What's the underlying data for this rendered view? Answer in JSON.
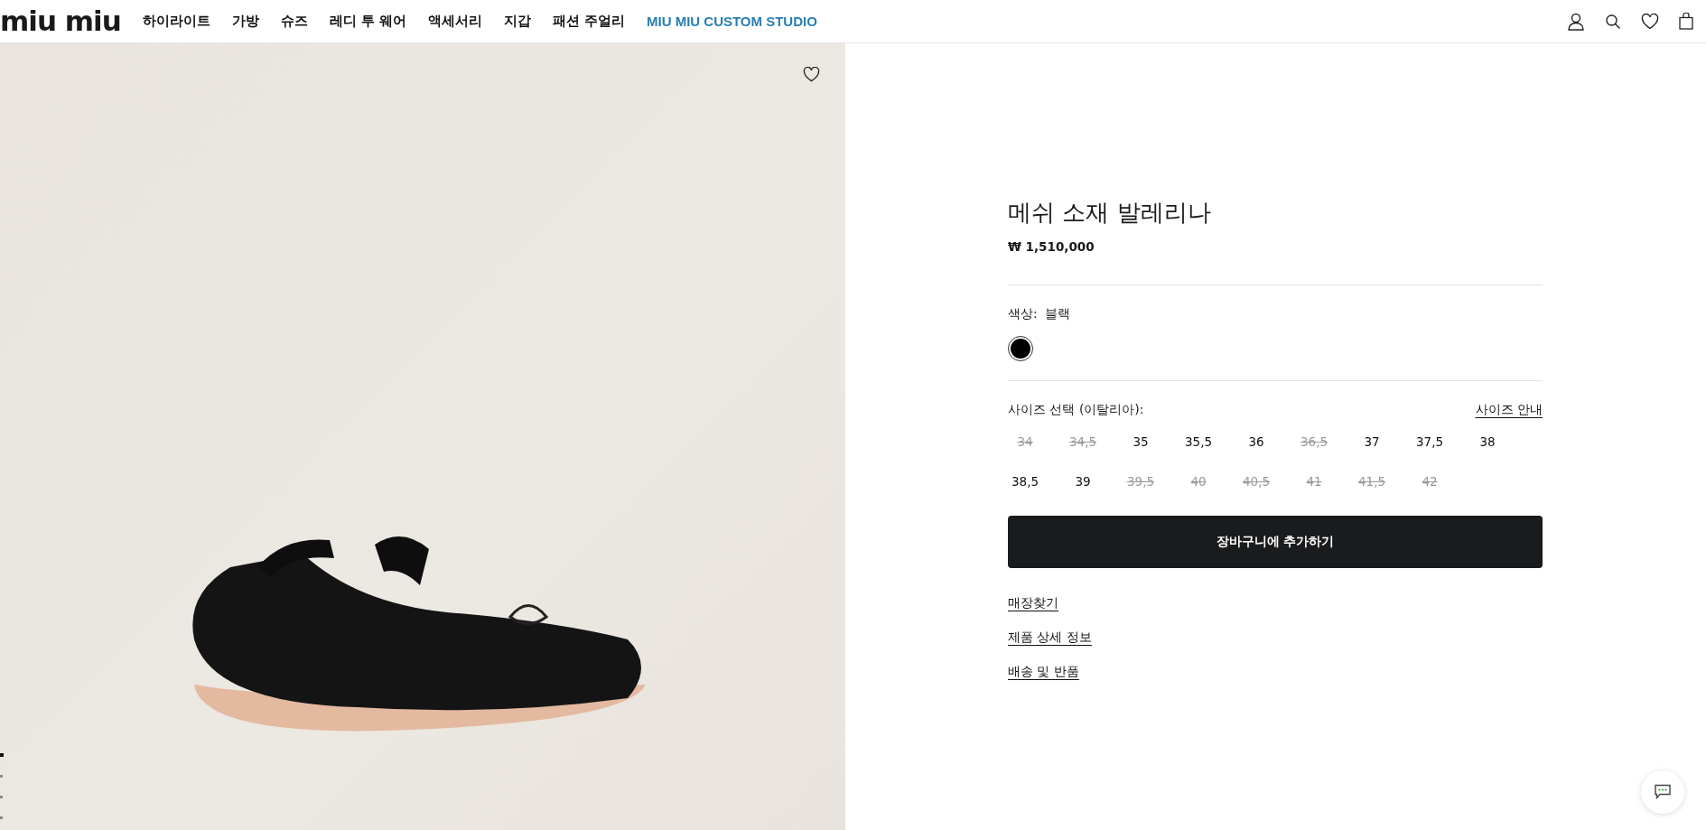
{
  "header": {
    "logo": "miu miu",
    "nav": [
      {
        "label": "하이라이트",
        "kind": "plain"
      },
      {
        "label": "가방",
        "kind": "plain"
      },
      {
        "label": "슈즈",
        "kind": "plain"
      },
      {
        "label": "레디 투 웨어",
        "kind": "plain"
      },
      {
        "label": "액세서리",
        "kind": "plain"
      },
      {
        "label": "지갑",
        "kind": "plain"
      },
      {
        "label": "패션 주얼리",
        "kind": "plain"
      },
      {
        "label": "MIU MIU CUSTOM STUDIO",
        "kind": "accent"
      }
    ]
  },
  "gallery": {
    "dots": [
      {
        "selected": true
      },
      {
        "selected": false
      },
      {
        "selected": false
      },
      {
        "selected": false
      }
    ]
  },
  "product": {
    "title": "메쉬 소재 발레리나",
    "price": "₩ 1,510,000",
    "color_label": "색상:",
    "color_value": "블랙",
    "swatches": [
      {
        "color": "#000000",
        "selected": true
      }
    ],
    "size_label": "사이즈 선택 (이탈리아):",
    "size_guide": "사이즈 안내",
    "sizes": [
      {
        "label": "34",
        "available": false
      },
      {
        "label": "34,5",
        "available": false
      },
      {
        "label": "35",
        "available": true
      },
      {
        "label": "35,5",
        "available": true
      },
      {
        "label": "36",
        "available": true
      },
      {
        "label": "36,5",
        "available": false
      },
      {
        "label": "37",
        "available": true
      },
      {
        "label": "37,5",
        "available": true
      },
      {
        "label": "38",
        "available": true
      },
      {
        "label": "38,5",
        "available": true
      },
      {
        "label": "39",
        "available": true
      },
      {
        "label": "39,5",
        "available": false
      },
      {
        "label": "40",
        "available": false
      },
      {
        "label": "40,5",
        "available": false
      },
      {
        "label": "41",
        "available": false
      },
      {
        "label": "41,5",
        "available": false
      },
      {
        "label": "42",
        "available": false
      }
    ],
    "add_to_cart": "장바구니에 추가하기",
    "links": [
      "매장찾기",
      "제품 상세 정보",
      "배송 및 반품"
    ]
  }
}
